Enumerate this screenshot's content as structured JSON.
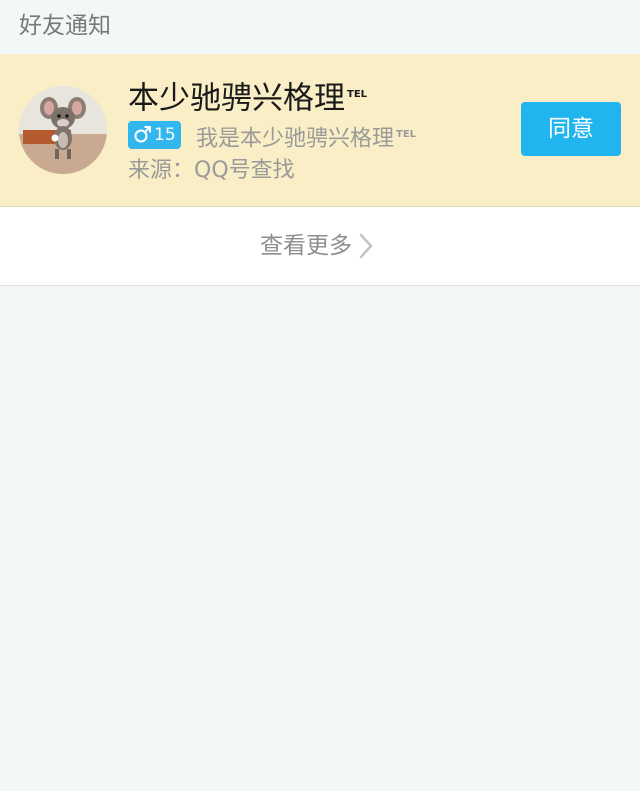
{
  "section": {
    "title": "好友通知"
  },
  "request": {
    "nickname": "本少驰骋兴格理",
    "nickname_suffix": "TEL",
    "avatar_icon": "cartoon-mouse-avatar",
    "gender_icon": "male-icon",
    "age": "15",
    "message": "我是本少驰骋兴格理",
    "message_suffix": "TEL",
    "source": "来源：QQ号查找",
    "accept_label": "同意"
  },
  "view_more": {
    "label": "查看更多",
    "icon": "chevron-right-icon"
  },
  "colors": {
    "page_background": "#f3f7f8",
    "card_highlight": "#f9eec6",
    "accent": "#21b5ef",
    "badge": "#31b6ee",
    "muted_text": "#9a9a9a"
  }
}
